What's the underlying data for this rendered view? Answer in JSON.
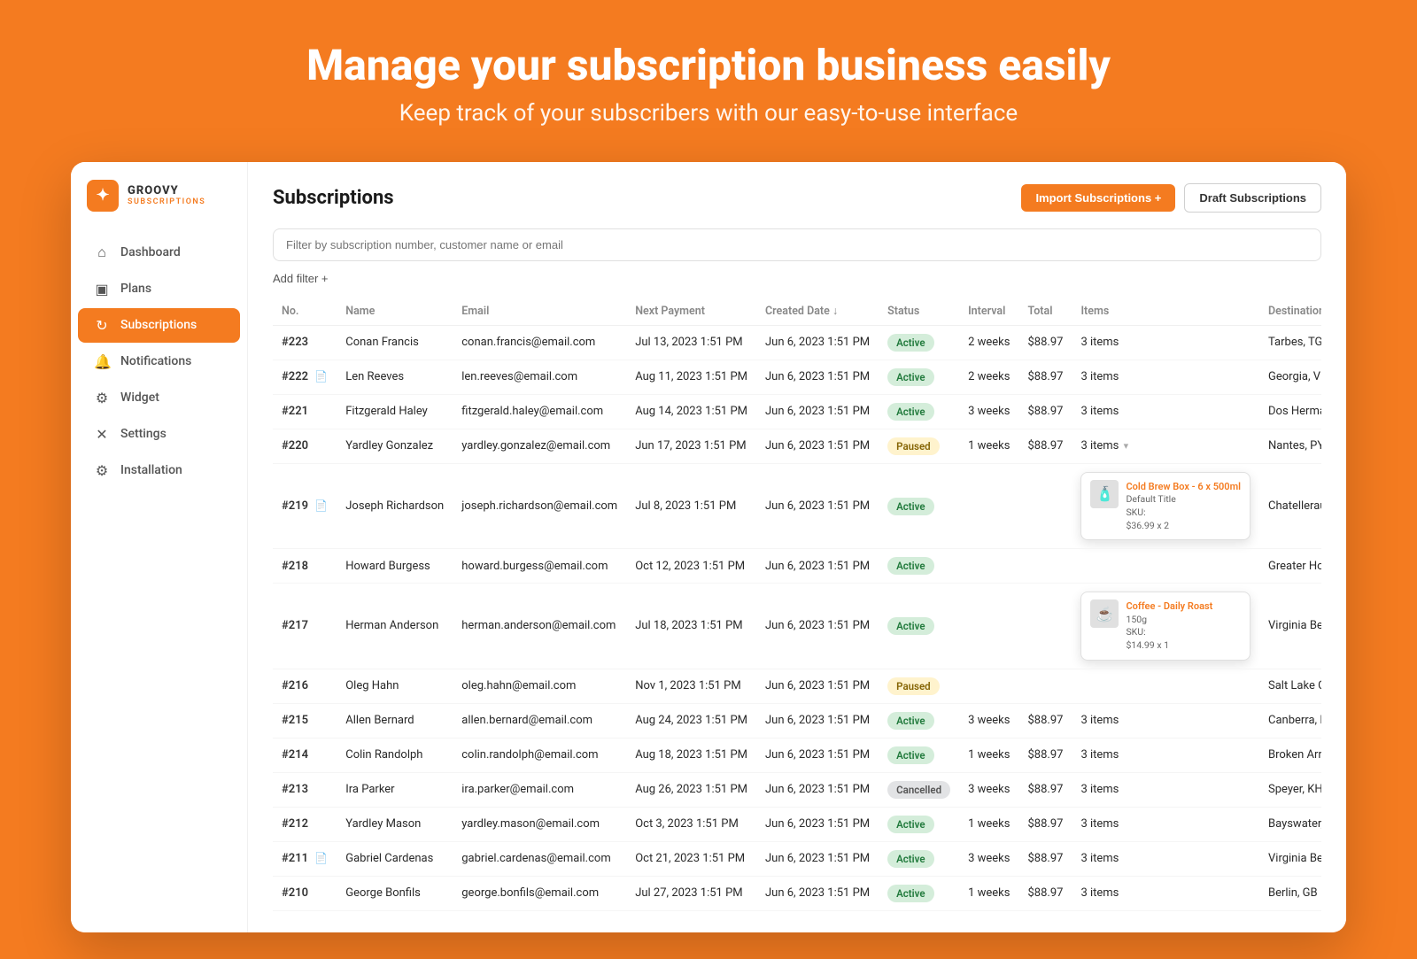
{
  "hero": {
    "title": "Manage your subscription business easily",
    "subtitle": "Keep track of your subscribers with our easy-to-use interface"
  },
  "sidebar": {
    "logo_name": "GROOVY",
    "logo_sub": "SUBSCRIPTIONS",
    "logo_icon": "✦",
    "nav_items": [
      {
        "id": "dashboard",
        "label": "Dashboard",
        "icon": "⌂",
        "active": false
      },
      {
        "id": "plans",
        "label": "Plans",
        "icon": "▣",
        "active": false
      },
      {
        "id": "subscriptions",
        "label": "Subscriptions",
        "icon": "↻",
        "active": true
      },
      {
        "id": "notifications",
        "label": "Notifications",
        "icon": "🔔",
        "active": false
      },
      {
        "id": "widget",
        "label": "Widget",
        "icon": "⚙",
        "active": false
      },
      {
        "id": "settings",
        "label": "Settings",
        "icon": "✕",
        "active": false
      },
      {
        "id": "installation",
        "label": "Installation",
        "icon": "⚙",
        "active": false
      }
    ]
  },
  "main": {
    "page_title": "Subscriptions",
    "import_btn": "Import Subscriptions +",
    "draft_btn": "Draft Subscriptions",
    "filter_placeholder": "Filter by subscription number, customer name or email",
    "add_filter_label": "Add filter +",
    "table": {
      "columns": [
        "No.",
        "Name",
        "Email",
        "Next Payment",
        "Created Date ↓",
        "Status",
        "Interval",
        "Total",
        "Items",
        "Destination"
      ],
      "rows": [
        {
          "no": "#223",
          "name": "Conan Francis",
          "email": "conan.francis@email.com",
          "next_payment": "Jul 13, 2023 1:51 PM",
          "created_date": "Jun 6, 2023 1:51 PM",
          "status": "Active",
          "status_type": "active",
          "interval": "2 weeks",
          "total": "$88.97",
          "items": "3 items",
          "destination": "Tarbes, TG",
          "has_doc": false,
          "has_dropdown": false
        },
        {
          "no": "#222",
          "name": "Len Reeves",
          "email": "len.reeves@email.com",
          "next_payment": "Aug 11, 2023 1:51 PM",
          "created_date": "Jun 6, 2023 1:51 PM",
          "status": "Active",
          "status_type": "active",
          "interval": "2 weeks",
          "total": "$88.97",
          "items": "3 items",
          "destination": "Georgia, VN",
          "has_doc": true,
          "has_dropdown": false
        },
        {
          "no": "#221",
          "name": "Fitzgerald Haley",
          "email": "fitzgerald.haley@email.com",
          "next_payment": "Aug 14, 2023 1:51 PM",
          "created_date": "Jun 6, 2023 1:51 PM",
          "status": "Active",
          "status_type": "active",
          "interval": "3 weeks",
          "total": "$88.97",
          "items": "3 items",
          "destination": "Dos Hermanas, VE",
          "has_doc": false,
          "has_dropdown": false
        },
        {
          "no": "#220",
          "name": "Yardley Gonzalez",
          "email": "yardley.gonzalez@email.com",
          "next_payment": "Jun 17, 2023 1:51 PM",
          "created_date": "Jun 6, 2023 1:51 PM",
          "status": "Paused",
          "status_type": "paused",
          "interval": "1 weeks",
          "total": "$88.97",
          "items": "3 items",
          "destination": "Nantes, PY",
          "has_doc": false,
          "has_dropdown": true
        },
        {
          "no": "#219",
          "name": "Joseph Richardson",
          "email": "joseph.richardson@email.com",
          "next_payment": "Jul 8, 2023 1:51 PM",
          "created_date": "Jun 6, 2023 1:51 PM",
          "status": "Active",
          "status_type": "active",
          "interval": "",
          "total": "",
          "items": "",
          "destination": "Chatellerault, NU",
          "has_doc": true,
          "has_dropdown": false,
          "tooltip": {
            "name": "Cold Brew Box - 6 x 500ml",
            "variant": "Default Title",
            "sku": "SKU:",
            "price": "$36.99 x 2",
            "icon": "🧴"
          }
        },
        {
          "no": "#218",
          "name": "Howard Burgess",
          "email": "howard.burgess@email.com",
          "next_payment": "Oct 12, 2023 1:51 PM",
          "created_date": "Jun 6, 2023 1:51 PM",
          "status": "Active",
          "status_type": "active",
          "interval": "",
          "total": "",
          "items": "",
          "destination": "Greater Hobart, AD",
          "has_doc": false,
          "has_dropdown": false
        },
        {
          "no": "#217",
          "name": "Herman Anderson",
          "email": "herman.anderson@email.com",
          "next_payment": "Jul 18, 2023 1:51 PM",
          "created_date": "Jun 6, 2023 1:51 PM",
          "status": "Active",
          "status_type": "active",
          "interval": "",
          "total": "",
          "items": "",
          "destination": "Virginia Beach, LT",
          "has_doc": false,
          "has_dropdown": false,
          "tooltip": {
            "name": "Coffee - Daily Roast",
            "variant": "150g",
            "sku": "SKU:",
            "price": "$14.99 x 1",
            "icon": "☕"
          }
        },
        {
          "no": "#216",
          "name": "Oleg Hahn",
          "email": "oleg.hahn@email.com",
          "next_payment": "Nov 1, 2023 1:51 PM",
          "created_date": "Jun 6, 2023 1:51 PM",
          "status": "Paused",
          "status_type": "paused",
          "interval": "",
          "total": "",
          "items": "",
          "destination": "Salt Lake City, NG",
          "has_doc": false,
          "has_dropdown": false
        },
        {
          "no": "#215",
          "name": "Allen Bernard",
          "email": "allen.bernard@email.com",
          "next_payment": "Aug 24, 2023 1:51 PM",
          "created_date": "Jun 6, 2023 1:51 PM",
          "status": "Active",
          "status_type": "active",
          "interval": "3 weeks",
          "total": "$88.97",
          "items": "3 items",
          "destination": "Canberra, MK",
          "has_doc": false,
          "has_dropdown": false
        },
        {
          "no": "#214",
          "name": "Colin Randolph",
          "email": "colin.randolph@email.com",
          "next_payment": "Aug 18, 2023 1:51 PM",
          "created_date": "Jun 6, 2023 1:51 PM",
          "status": "Active",
          "status_type": "active",
          "interval": "1 weeks",
          "total": "$88.97",
          "items": "3 items",
          "destination": "Broken Arrow, ID",
          "has_doc": false,
          "has_dropdown": false
        },
        {
          "no": "#213",
          "name": "Ira Parker",
          "email": "ira.parker@email.com",
          "next_payment": "Aug 26, 2023 1:51 PM",
          "created_date": "Jun 6, 2023 1:51 PM",
          "status": "Cancelled",
          "status_type": "cancelled",
          "interval": "3 weeks",
          "total": "$88.97",
          "items": "3 items",
          "destination": "Speyer, KH",
          "has_doc": false,
          "has_dropdown": false
        },
        {
          "no": "#212",
          "name": "Yardley Mason",
          "email": "yardley.mason@email.com",
          "next_payment": "Oct 3, 2023 1:51 PM",
          "created_date": "Jun 6, 2023 1:51 PM",
          "status": "Active",
          "status_type": "active",
          "interval": "1 weeks",
          "total": "$88.97",
          "items": "3 items",
          "destination": "Bayswater, SI",
          "has_doc": false,
          "has_dropdown": false
        },
        {
          "no": "#211",
          "name": "Gabriel Cardenas",
          "email": "gabriel.cardenas@email.com",
          "next_payment": "Oct 21, 2023 1:51 PM",
          "created_date": "Jun 6, 2023 1:51 PM",
          "status": "Active",
          "status_type": "active",
          "interval": "3 weeks",
          "total": "$88.97",
          "items": "3 items",
          "destination": "Virginia Beach, LT",
          "has_doc": true,
          "has_dropdown": false
        },
        {
          "no": "#210",
          "name": "George Bonfils",
          "email": "george.bonfils@email.com",
          "next_payment": "Jul 27, 2023 1:51 PM",
          "created_date": "Jun 6, 2023 1:51 PM",
          "status": "Active",
          "status_type": "active",
          "interval": "1 weeks",
          "total": "$88.97",
          "items": "3 items",
          "destination": "Berlin, GB",
          "has_doc": false,
          "has_dropdown": false
        }
      ]
    }
  }
}
